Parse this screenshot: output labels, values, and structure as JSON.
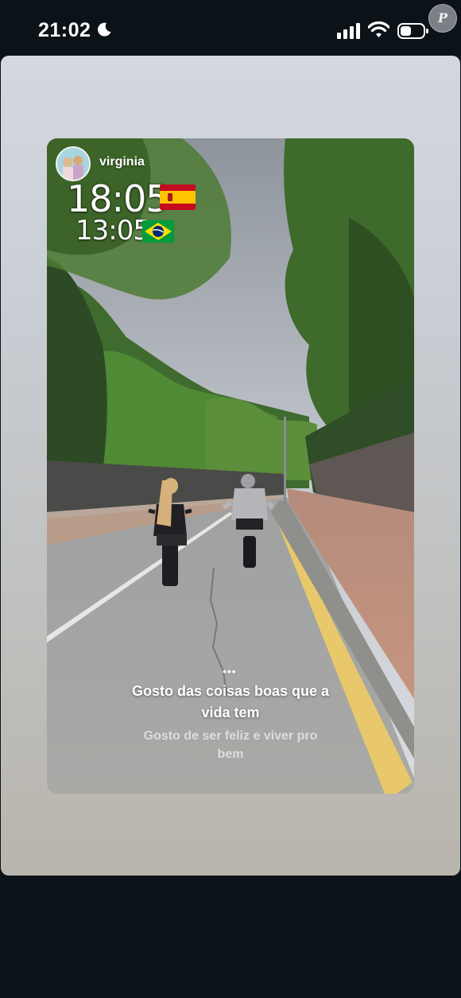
{
  "status_bar": {
    "time": "21:02",
    "icons": [
      "moon-icon",
      "signal-icon",
      "wifi-icon",
      "battery-icon"
    ]
  },
  "watermark": "P",
  "story": {
    "username": "virginia",
    "clocks": [
      {
        "time": "18:05",
        "flag": "spain-flag-icon"
      },
      {
        "time": "13:05",
        "flag": "brazil-flag-icon"
      }
    ],
    "caption_main": "Gosto das coisas boas que a vida tem",
    "caption_sub": "Gosto de ser feliz e viver pro bem"
  },
  "colors": {
    "background": "#0b1218",
    "card": "#c9ced5",
    "spain_red": "#c60b1e",
    "spain_yellow": "#ffc400",
    "brazil_green": "#009c3b",
    "brazil_yellow": "#ffdf00",
    "brazil_blue": "#002776"
  }
}
